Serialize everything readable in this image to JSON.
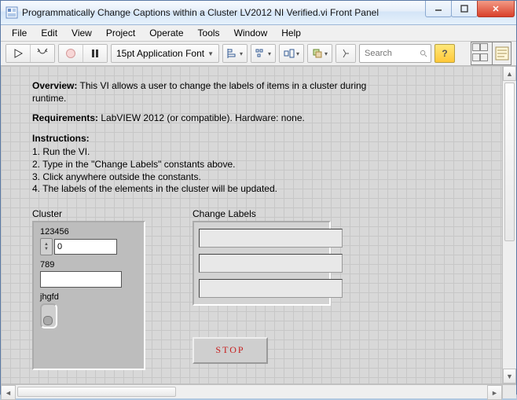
{
  "window": {
    "title": "Programmatically Change Captions within a Cluster LV2012 NI Verified.vi Front Panel"
  },
  "menu": [
    "File",
    "Edit",
    "View",
    "Project",
    "Operate",
    "Tools",
    "Window",
    "Help"
  ],
  "toolbar": {
    "font_label": "15pt Application Font",
    "search_placeholder": "Search",
    "help_glyph": "?"
  },
  "doc": {
    "overview_h": "Overview:",
    "overview_b": " This VI allows a user to change the labels of items in a cluster during runtime.",
    "req_h": "Requirements:",
    "req_b": " LabVIEW 2012 (or compatible). Hardware: none.",
    "instr_h": "Instructions:",
    "steps": [
      "1. Run the VI.",
      "2. Type in the \"Change Labels\" constants above.",
      "3. Click anywhere outside the constants.",
      "4. The labels of the elements in the cluster will be updated."
    ]
  },
  "cluster": {
    "title": "Cluster",
    "num_label": "123456",
    "num_value": "0",
    "str_label": "789",
    "bool_label": "jhgfd"
  },
  "change_labels": {
    "title": "Change Labels",
    "values": [
      "",
      "",
      ""
    ]
  },
  "stop": {
    "label": "STOP"
  }
}
